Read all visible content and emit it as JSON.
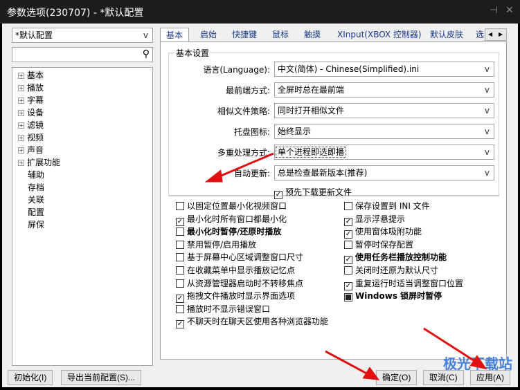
{
  "window": {
    "title": "参数选项(230707) - *默认配置",
    "pin_icon": "pin-icon",
    "close_icon": "close-icon"
  },
  "left": {
    "profile": "*默认配置",
    "search_placeholder": "",
    "tree": [
      {
        "label": "基本",
        "expandable": true
      },
      {
        "label": "播放",
        "expandable": true
      },
      {
        "label": "字幕",
        "expandable": true
      },
      {
        "label": "设备",
        "expandable": true
      },
      {
        "label": "滤镜",
        "expandable": true
      },
      {
        "label": "视频",
        "expandable": true
      },
      {
        "label": "声音",
        "expandable": true
      },
      {
        "label": "扩展功能",
        "expandable": true
      },
      {
        "label": "辅助",
        "expandable": false
      },
      {
        "label": "存档",
        "expandable": false
      },
      {
        "label": "关联",
        "expandable": false
      },
      {
        "label": "配置",
        "expandable": false
      },
      {
        "label": "屏保",
        "expandable": false
      }
    ]
  },
  "tabs": [
    "基本",
    "启始",
    "快捷键",
    "鼠标",
    "触摸",
    "XInput(XBOX 控制器)",
    "默认皮肤",
    "选"
  ],
  "group": {
    "title": "基本设置",
    "rows": [
      {
        "label": "语言(Language):",
        "value": "中文(简体) - Chinese(Simplified).ini"
      },
      {
        "label": "最前端方式:",
        "value": "全屏时总在最前端"
      },
      {
        "label": "相似文件策略:",
        "value": "同时打开相似文件"
      },
      {
        "label": "托盘图标:",
        "value": "始终显示"
      },
      {
        "label": "多重处理方式:",
        "value": "单个进程即选即播"
      },
      {
        "label": "自动更新:",
        "value": "总是检查最新版本(推荐)"
      }
    ],
    "predownload": {
      "label": "预先下载更新文件",
      "checked": true
    }
  },
  "checks_left": [
    {
      "label": "以固定位置最小化视频窗口",
      "state": "off"
    },
    {
      "label": "最小化时所有窗口都最小化",
      "state": "on"
    },
    {
      "label": "最小化时暂停/还原时播放",
      "state": "off",
      "bold": true
    },
    {
      "label": "禁用暂停/启用播放",
      "state": "off"
    },
    {
      "label": "基于屏幕中心区域调整窗口尺寸",
      "state": "off"
    },
    {
      "label": "在收藏菜单中显示播放记忆点",
      "state": "off"
    },
    {
      "label": "从资源管理器启动时不转移焦点",
      "state": "off"
    },
    {
      "label": "拖拽文件播放时显示界面选项",
      "state": "on"
    },
    {
      "label": "播放时不显示错误窗口",
      "state": "off"
    },
    {
      "label": "不聊天时在聊天区使用各种浏览器功能",
      "state": "on"
    }
  ],
  "checks_right": [
    {
      "label": "保存设置到 INI 文件",
      "state": "off"
    },
    {
      "label": "显示浮悬提示",
      "state": "on"
    },
    {
      "label": "使用窗体吸附功能",
      "state": "on"
    },
    {
      "label": "暂停时保存配置",
      "state": "off"
    },
    {
      "label": "使用任务栏播放控制功能",
      "state": "on",
      "bold": true
    },
    {
      "label": "关闭时还原为默认尺寸",
      "state": "off"
    },
    {
      "label": "重复运行时适当调整窗口位置",
      "state": "on"
    },
    {
      "label": "Windows 锁屏时暂停",
      "state": "mixed",
      "bold": true
    }
  ],
  "buttons": {
    "init": "初始化(I)",
    "export": "导出当前配置(S)...",
    "ok": "确定(O)",
    "cancel": "取消(C)",
    "apply": "应用(A)"
  },
  "watermark": "极光下载站",
  "colors": {
    "titlebar": "#1c1c1c",
    "arrow": "#e01010",
    "tab_text": "#1a3a8a"
  }
}
